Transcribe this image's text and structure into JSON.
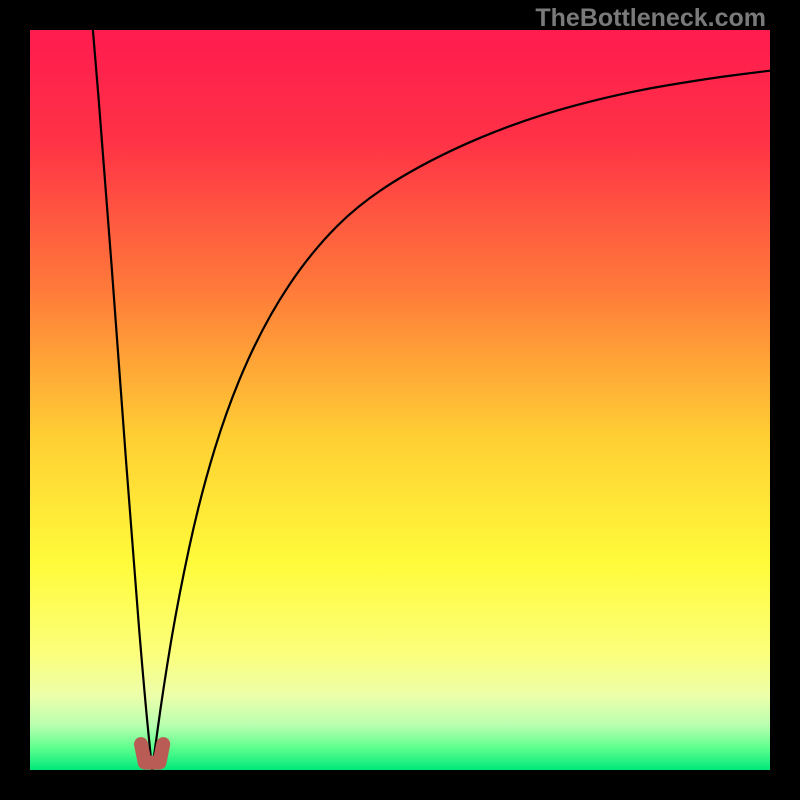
{
  "watermark": "TheBottleneck.com",
  "chart_data": {
    "type": "line",
    "title": "",
    "xlabel": "",
    "ylabel": "",
    "xlim": [
      0,
      1
    ],
    "ylim": [
      0,
      1
    ],
    "background_gradient_stops": [
      {
        "pos": 0.0,
        "color": "#ff1b4f"
      },
      {
        "pos": 0.15,
        "color": "#ff3246"
      },
      {
        "pos": 0.35,
        "color": "#ff7a3a"
      },
      {
        "pos": 0.55,
        "color": "#ffcf33"
      },
      {
        "pos": 0.72,
        "color": "#fffb3a"
      },
      {
        "pos": 0.84,
        "color": "#fcff7a"
      },
      {
        "pos": 0.9,
        "color": "#ecffaa"
      },
      {
        "pos": 0.94,
        "color": "#b8ffb0"
      },
      {
        "pos": 0.97,
        "color": "#5eff8e"
      },
      {
        "pos": 1.0,
        "color": "#00e87a"
      }
    ],
    "trough_x": 0.165,
    "series": [
      {
        "name": "left-branch",
        "x": [
          0.085,
          0.1,
          0.12,
          0.14,
          0.155,
          0.165
        ],
        "values": [
          1.0,
          0.82,
          0.55,
          0.28,
          0.1,
          0.0
        ]
      },
      {
        "name": "right-branch",
        "x": [
          0.165,
          0.18,
          0.2,
          0.23,
          0.27,
          0.32,
          0.38,
          0.45,
          0.55,
          0.67,
          0.8,
          0.92,
          1.0
        ],
        "values": [
          0.0,
          0.11,
          0.23,
          0.37,
          0.5,
          0.61,
          0.7,
          0.77,
          0.83,
          0.88,
          0.915,
          0.935,
          0.945
        ]
      }
    ],
    "trough_marker": {
      "shape": "u",
      "color": "#b95c55",
      "x": [
        0.15,
        0.155,
        0.165,
        0.175,
        0.18
      ],
      "y": [
        0.035,
        0.01,
        0.01,
        0.01,
        0.035
      ]
    }
  }
}
